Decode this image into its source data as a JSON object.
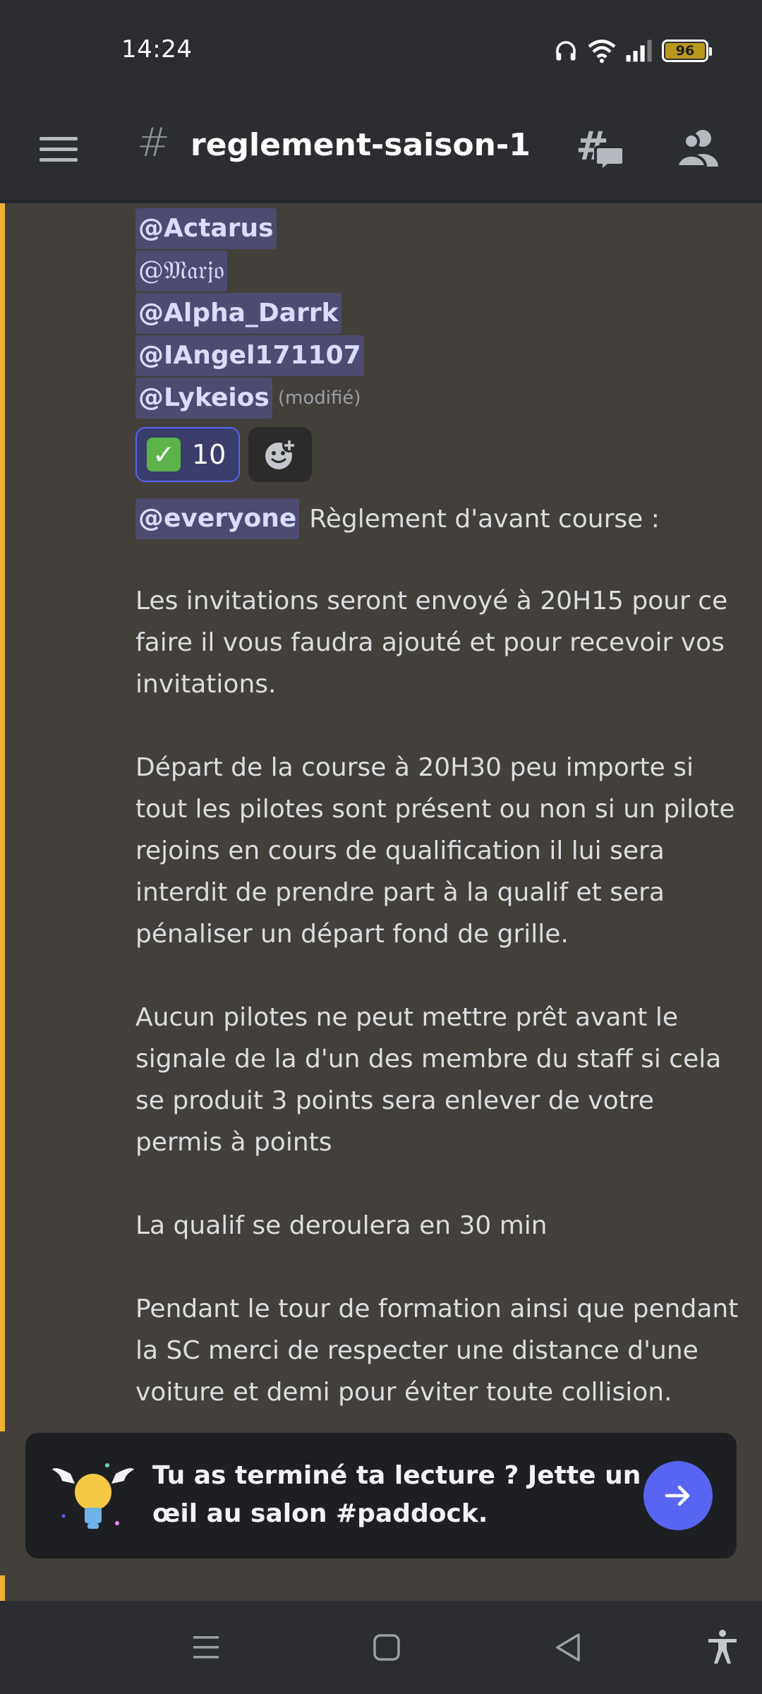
{
  "status_bar": {
    "time": "14:24",
    "battery": "96",
    "icons": [
      "headphones-icon",
      "wifi-icon",
      "signal-icon",
      "battery-icon"
    ]
  },
  "header": {
    "channel_name": "reglement-saison-1",
    "icons": [
      "menu-icon",
      "hash-icon",
      "threads-icon",
      "members-icon"
    ]
  },
  "message": {
    "mentions": [
      "@Actarus",
      "@𝔐𝔞𝔯𝔧𝔬",
      "@Alpha_Darrk",
      "@IAngel171107",
      "@Lykeios"
    ],
    "edited_label": "(modifié)",
    "reaction": {
      "emoji": "✓",
      "count": "10"
    },
    "everyone_mention": "@everyone",
    "intro": "Règlement d'avant course :",
    "paragraphs": [
      "Les invitations seront envoyé à 20H15 pour ce\nfaire il vous faudra ajouté  et pour recevoir vos\ninvitations.",
      "Départ de la course à 20H30 peu importe si\ntout les pilotes sont présent ou non si un pilote\nrejoins en cours de qualification il lui sera\ninterdit de prendre part à la qualif et sera\npénaliser un départ fond de grille.",
      "Aucun pilotes ne peut mettre prêt avant le\nsignale de la d'un des membre du staff si cela\nse produit 3 points sera enlever de votre\npermis à points",
      "La qualif se deroulera en 30 min",
      "Pendant le tour de formation ainsi que pendant\nla SC merci de respecter une distance d'une\nvoiture et demi pour éviter toute collision."
    ]
  },
  "banner": {
    "text": "Tu as terminé ta lecture ? Jette un œil au salon #paddock."
  },
  "colors": {
    "accent": "#f0b232",
    "brand": "#5865f2",
    "mention_bg": "#4d4b70",
    "content_bg": "#433f3a"
  }
}
